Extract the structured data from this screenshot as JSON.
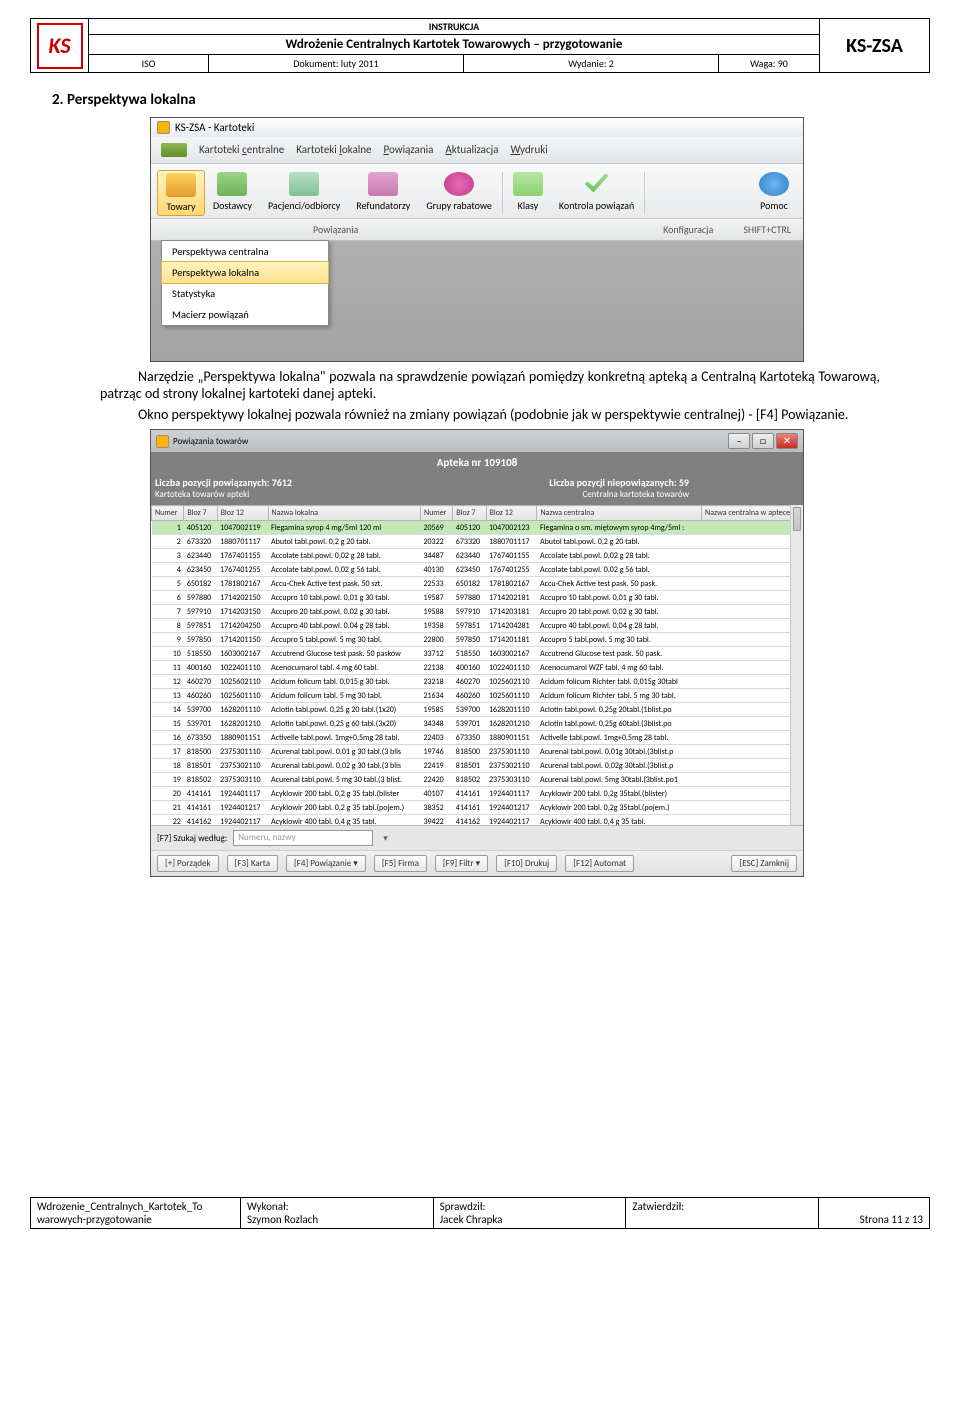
{
  "header": {
    "instr": "INSTRUKCJA",
    "title": "Wdrożenie Centralnych Kartotek Towarowych – przygotowanie",
    "iso": "ISO",
    "doc": "Dokument: luty 2011",
    "wyd": "Wydanie: 2",
    "waga": "Waga: 90",
    "app": "KS-ZSA"
  },
  "sec": "2.   Perspektywa lokalna",
  "p1": "Narzędzie „Perspektywa lokalna\" pozwala na sprawdzenie powiązań pomiędzy konkretną apteką a Centralną Kartoteką Towarową, patrząc od strony lokalnej kartoteki danej apteki.",
  "p2": "Okno perspektywy lokalnej pozwala również na zmiany powiązań (podobnie jak w perspektywie centralnej) - [F4] Powiązanie.",
  "sc1": {
    "title": "KS-ZSA - Kartoteki",
    "menu": [
      "Kartoteki centralne",
      "Kartoteki lokalne",
      "Powiązania",
      "Aktualizacja",
      "Wydruki"
    ],
    "tb": [
      "Towary",
      "Dostawcy",
      "Pacjenci/odbiorcy",
      "Refundatorzy",
      "Grupy rabatowe",
      "Klasy",
      "Kontrola powiązań",
      "Pomoc"
    ],
    "sub": [
      "Powiązania",
      "Konfiguracja",
      "SHIFT+CTRL"
    ],
    "dd": [
      "Perspektywa centralna",
      "Perspektywa lokalna",
      "Statystyka",
      "Macierz powiązań"
    ]
  },
  "sc2": {
    "wt": "Powiązania towarów",
    "apt": "Apteka nr 109108",
    "left_h1": "Liczba pozycji powiązanych: 7612",
    "left_h2": "Kartoteka towarów apteki",
    "right_h1": "Liczba pozycji niepowiązanych: 59",
    "right_h2": "Centralna kartoteka towarów",
    "th": [
      "Numer",
      "Bloz 7",
      "Bloz 12",
      "Nazwa lokalna",
      "Numer",
      "Bloz 7",
      "Bloz 12",
      "Nazwa centralna",
      "Nazwa centralna w aptece"
    ],
    "search_lbl": "[F7] Szukaj według:",
    "search_ph": "Numeru, nazwy",
    "btns": [
      "[+] Porządek",
      "[F3] Karta",
      "[F4] Powiązanie ▾",
      "[F5] Firma",
      "[F9] Filtr ▾",
      "[F10] Drukuj",
      "[F12] Automat"
    ],
    "close": "[ESC] Zamknij"
  },
  "chart_data": {
    "type": "table",
    "columns": [
      "Numer",
      "Bloz 7",
      "Bloz 12",
      "Nazwa lokalna",
      "Numer",
      "Bloz 7",
      "Bloz 12",
      "Nazwa centralna"
    ],
    "rows": [
      [
        1,
        "405120",
        "1047002119",
        "Flegamina syrop 4 mg/5ml 120 ml",
        "20569",
        "405120",
        "1047002123",
        "Flegamina o sm. miętowym syrop 4mg/5ml :"
      ],
      [
        2,
        "673320",
        "1880701117",
        "Abutol tabl.powl. 0,2 g 20 tabl.",
        "20322",
        "673320",
        "1880701117",
        "Abutol tabl.powl. 0,2 g 20 tabl."
      ],
      [
        3,
        "623440",
        "1767401155",
        "Accolate tabl.powl. 0,02 g 28 tabl.",
        "34487",
        "623440",
        "1767401155",
        "Accolate tabl.powl. 0,02 g 28 tabl."
      ],
      [
        4,
        "623450",
        "1767401255",
        "Accolate tabl.powl. 0,02 g 56 tabl.",
        "40130",
        "623450",
        "1767401255",
        "Accolate tabl.powl. 0,02 g 56 tabl."
      ],
      [
        5,
        "650182",
        "1781802167",
        "Accu-Chek Active test pask. 50 szt.",
        "22533",
        "650182",
        "1781802167",
        "Accu-Chek Active test pask. 50 pask."
      ],
      [
        6,
        "597880",
        "1714202150",
        "Accupro 10 tabl.powl. 0,01 g 30 tabl.",
        "19587",
        "597880",
        "1714202181",
        "Accupro 10 tabl.powl. 0,01 g 30 tabl."
      ],
      [
        7,
        "597910",
        "1714203150",
        "Accupro 20 tabl.powl. 0,02 g 30 tabl.",
        "19588",
        "597910",
        "1714203181",
        "Accupro 20 tabl.powl. 0,02 g 30 tabl."
      ],
      [
        8,
        "597851",
        "1714204250",
        "Accupro 40 tabl.powl. 0,04 g 28 tabl.",
        "19358",
        "597851",
        "1714204281",
        "Accupro 40 tabl.powl. 0,04 g 28 tabl."
      ],
      [
        9,
        "597850",
        "1714201150",
        "Accupro 5 tabl.powl. 5 mg 30 tabl.",
        "22800",
        "597850",
        "1714201181",
        "Accupro 5 tabl.powl. 5 mg 30 tabl."
      ],
      [
        10,
        "518550",
        "1603002167",
        "Accutrend Glucose test pask. 50 pasków",
        "33712",
        "518550",
        "1603002167",
        "Accutrend Glucose test pask. 50 pask."
      ],
      [
        11,
        "400160",
        "1022401110",
        "Acenocumarol tabl. 4 mg 60 tabl.",
        "22138",
        "400160",
        "1022401110",
        "Acenocumarol WZF tabl. 4 mg 60 tabl."
      ],
      [
        12,
        "460270",
        "1025602110",
        "Acidum folicum tabl. 0,015 g 30 tabl.",
        "23218",
        "460270",
        "1025602110",
        "Acidum folicum Richter tabl. 0,015g 30tabl"
      ],
      [
        13,
        "460260",
        "1025601110",
        "Acidum folicum tabl. 5 mg 30 tabl.",
        "21634",
        "460260",
        "1025601110",
        "Acidum folicum Richter tabl. 5 mg 30 tabl."
      ],
      [
        14,
        "539700",
        "1628201110",
        "Aclotin tabl.powl. 0,25 g 20 tabl.(1x20)",
        "19585",
        "539700",
        "1628201110",
        "Aclotin tabl.powl. 0,25g 20tabl.(1blist.po"
      ],
      [
        15,
        "539701",
        "1628201210",
        "Aclotin tabl.powl. 0,25 g 60 tabl.(3x20)",
        "34348",
        "539701",
        "1628201210",
        "Aclotin tabl.powl. 0,25g 60tabl.(3blist.po"
      ],
      [
        16,
        "673350",
        "1880901151",
        "Activelle tabl.powl. 1mg+0,5mg 28 tabl.",
        "22403",
        "673350",
        "1880901151",
        "Activelle tabl.powl. 1mg+0,5mg 28 tabl."
      ],
      [
        17,
        "818500",
        "2375301110",
        "Acurenal tabl.powl. 0,01 g 30 tabl.(3 blis",
        "19746",
        "818500",
        "2375301110",
        "Acurenal tabl.powl. 0,01g 30tabl.(3blist.p"
      ],
      [
        18,
        "818501",
        "2375302110",
        "Acurenal tabl.powl. 0,02 g 30 tabl.(3 blis",
        "22419",
        "818501",
        "2375302110",
        "Acurenal tabl.powl. 0,02g 30tabl.(3blist.p"
      ],
      [
        19,
        "818502",
        "2375303110",
        "Acurenal tabl.powl. 5 mg 30 tabl.(3 blist.",
        "22420",
        "818502",
        "2375303110",
        "Acurenal tabl.powl. 5mg 30tabl.(3blist.po1"
      ],
      [
        20,
        "414161",
        "1924401117",
        "Acyklowir 200 tabl. 0,2 g 35 tabl.(blister",
        "40107",
        "414161",
        "1924401117",
        "Acyklowir 200 tabl. 0,2g 35tabl.(blister)"
      ],
      [
        21,
        "414161",
        "1924401217",
        "Acyklowir 200 tabl. 0,2 g 35 tabl.(pojem.)",
        "38352",
        "414161",
        "1924401217",
        "Acyklowir 200 tabl. 0,2g 35tabl.(pojem.)"
      ],
      [
        22,
        "414162",
        "1924402117",
        "Acyklowir 400 tabl. 0,4 g 35 tabl.",
        "39422",
        "414162",
        "1924402117",
        "Acyklowir 400 tabl. 0,4 g 35 tabl."
      ]
    ]
  },
  "footer": {
    "f1a": "Wdrozenie_Centralnych_Kartotek_To",
    "f1b": "warowych-przygotowanie",
    "f2a": "Wykonał:",
    "f2b": "Szymon Rozlach",
    "f3a": "Sprawdził:",
    "f3b": "Jacek Chrapka",
    "f4a": "Zatwierdził:",
    "page": "Strona 11 z 13"
  }
}
